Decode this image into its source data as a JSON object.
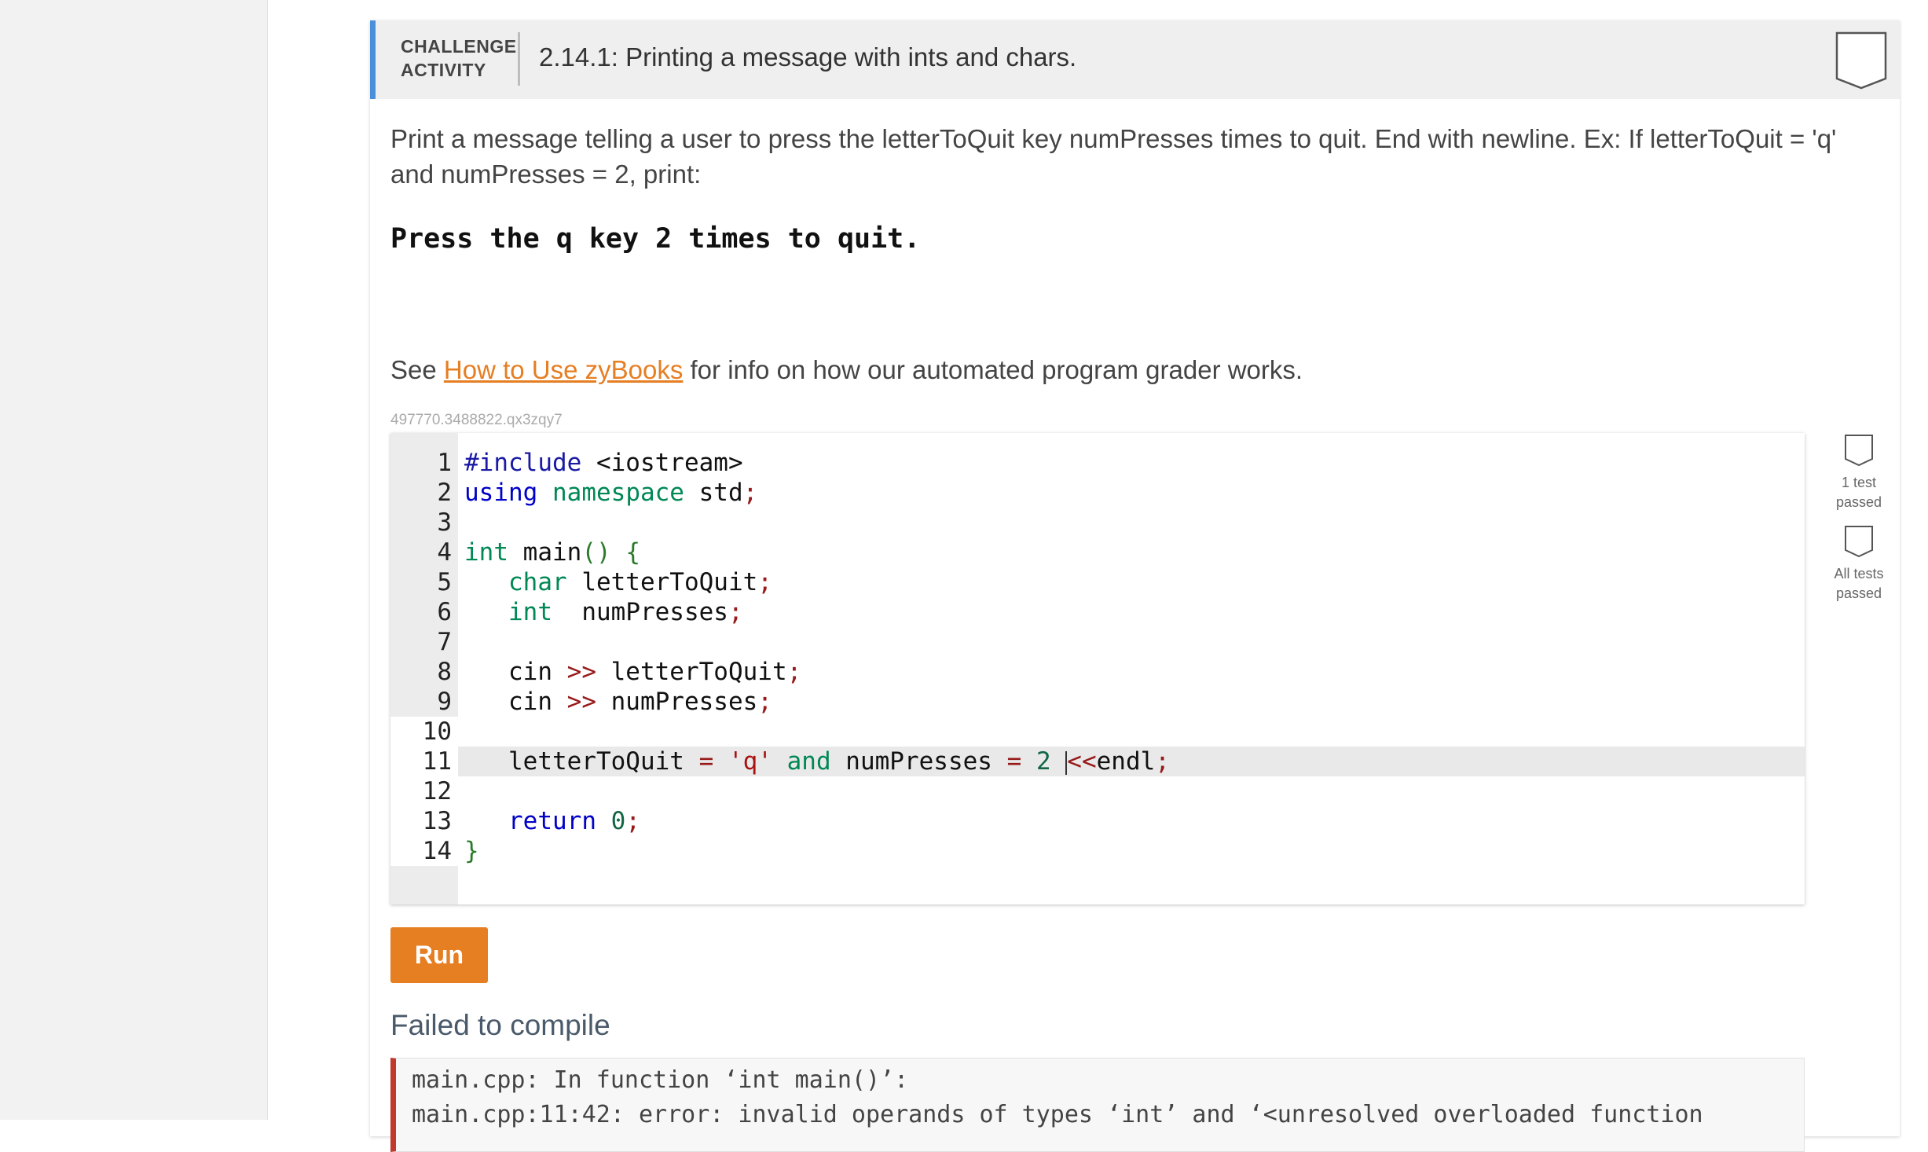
{
  "activity": {
    "type_label": "CHALLENGE ACTIVITY",
    "title": "2.14.1: Printing a message with ints and chars."
  },
  "prompt": {
    "text": "Print a message telling a user to press the letterToQuit key numPresses times to quit. End with newline. Ex: If letterToQuit = 'q' and numPresses = 2, print:",
    "example_output": "Press the q key 2 times to quit."
  },
  "help": {
    "prefix": "See ",
    "link_text": "How to Use zyBooks",
    "suffix": " for info on how our automated program grader works."
  },
  "activity_id": "497770.3488822.qx3zqy7",
  "editor": {
    "line_numbers": [
      "1",
      "2",
      "3",
      "4",
      "5",
      "6",
      "7",
      "8",
      "9",
      "10",
      "11",
      "12",
      "13",
      "14"
    ],
    "active_line": 11
  },
  "status": {
    "test1_label": "1 test passed",
    "all_label": "All tests passed"
  },
  "run_label": "Run",
  "result": {
    "heading": "Failed to compile",
    "lines": [
      "main.cpp: In function ‘int main()’:",
      "main.cpp:11:42: error: invalid operands of types ‘int’ and ‘<unresolved overloaded function"
    ]
  },
  "colors": {
    "accent_blue": "#4a90d9",
    "run_orange": "#e67e22",
    "error_red": "#c0392b"
  }
}
